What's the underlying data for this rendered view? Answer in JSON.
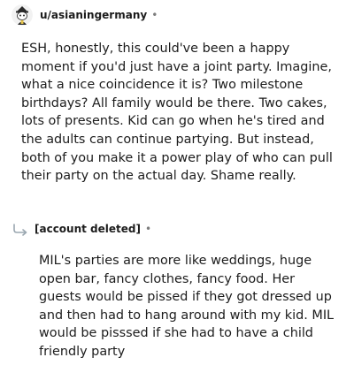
{
  "comments": [
    {
      "author": "u/asianingermany",
      "separator": "•",
      "avatar_icon": "snoo-avatar-icon",
      "body": "ESH, honestly, this could've been a happy moment if you'd just have a joint party. Imagine, what a nice coincidence it is? Two milestone birthdays? All family would be there. Two cakes, lots of presents. Kid can go when he's tired and the adults can continue partying. But instead, both of you make it a power play of who can pull their party on the actual day. Shame really."
    },
    {
      "author": "[account deleted]",
      "separator": "•",
      "reply_icon": "reply-arrow-icon",
      "body": "MIL's parties are more like weddings, huge open bar, fancy clothes, fancy food. Her guests would be pissed if they got dressed up and then had to hang around with my kid. MIL would be pisssed if she had to have a child friendly party"
    }
  ],
  "colors": {
    "text": "#1c1c1c",
    "meta": "#7c7c7c",
    "reply_arrow": "#9aa7b0"
  }
}
